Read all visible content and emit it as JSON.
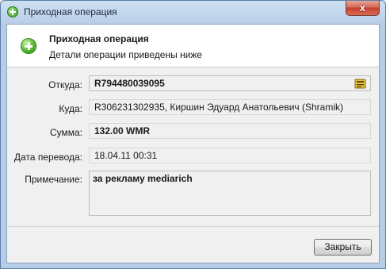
{
  "window": {
    "title": "Приходная операция",
    "close_glyph": "x"
  },
  "header": {
    "title": "Приходная операция",
    "subtitle": "Детали операции приведены ниже"
  },
  "fields": {
    "from": {
      "label": "Откуда:",
      "value": "R794480039095"
    },
    "to": {
      "label": "Куда:",
      "value": "R306231302935, Киршин Эдуард Анатольевич (Shramik)"
    },
    "amount": {
      "label": "Сумма:",
      "value": "132.00 WMR"
    },
    "date": {
      "label": "Дата перевода:",
      "value": "18.04.11 00:31"
    },
    "note": {
      "label": "Примечание:",
      "value": "за рекламу mediarich"
    }
  },
  "buttons": {
    "close_label": "Закрыть"
  },
  "icons": {
    "title": "add-green-icon",
    "header": "add-green-icon",
    "wallet": "wallet-icon"
  },
  "colors": {
    "accent_green": "#3fa625",
    "close_red": "#c4402f"
  }
}
